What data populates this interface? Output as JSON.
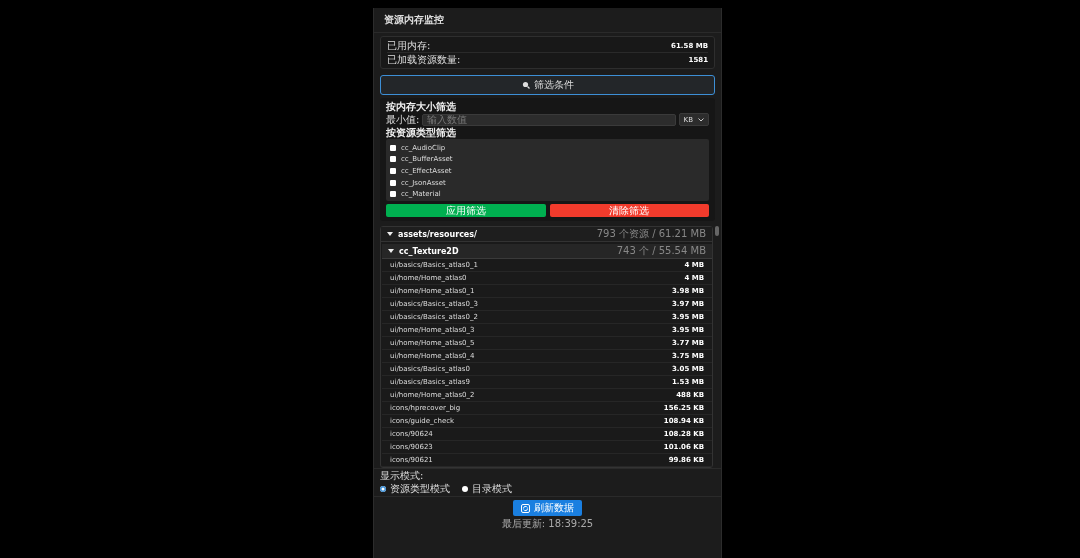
{
  "title": "资源内存监控",
  "stats": [
    {
      "label": "已用内存:",
      "value": "61.58 MB"
    },
    {
      "label": "已加载资源数量:",
      "value": "1581"
    }
  ],
  "filter_toggle": {
    "label": "筛选条件",
    "expanded": true
  },
  "filters": {
    "size_heading": "按内存大小筛选",
    "min_label": "最小值:",
    "min_input": {
      "placeholder": "输入数值"
    },
    "unit": "KB",
    "type_heading": "按资源类型筛选",
    "types": [
      {
        "label": "cc_AudioClip",
        "checked": false
      },
      {
        "label": "cc_BufferAsset",
        "checked": false
      },
      {
        "label": "cc_EffectAsset",
        "checked": false
      },
      {
        "label": "cc_JsonAsset",
        "checked": false
      },
      {
        "label": "cc_Material",
        "checked": false
      }
    ],
    "apply": "应用筛选",
    "clear": "清除筛选"
  },
  "tree": {
    "label": "assets/resources/",
    "summary": "793 个资源 / 61.21 MB",
    "expanded": true,
    "groups": [
      {
        "label": "cc_Texture2D",
        "summary": "743 个 / 55.54 MB",
        "expanded": true,
        "rows": [
          {
            "path": "ui/basics/Basics_atlas0_1",
            "size": "4 MB"
          },
          {
            "path": "ui/home/Home_atlas0",
            "size": "4 MB"
          },
          {
            "path": "ui/home/Home_atlas0_1",
            "size": "3.98 MB"
          },
          {
            "path": "ui/basics/Basics_atlas0_3",
            "size": "3.97 MB"
          },
          {
            "path": "ui/basics/Basics_atlas0_2",
            "size": "3.95 MB"
          },
          {
            "path": "ui/home/Home_atlas0_3",
            "size": "3.95 MB"
          },
          {
            "path": "ui/home/Home_atlas0_5",
            "size": "3.77 MB"
          },
          {
            "path": "ui/home/Home_atlas0_4",
            "size": "3.75 MB"
          },
          {
            "path": "ui/basics/Basics_atlas0",
            "size": "3.05 MB"
          },
          {
            "path": "ui/basics/Basics_atlas9",
            "size": "1.53 MB"
          },
          {
            "path": "ui/home/Home_atlas0_2",
            "size": "488 KB"
          },
          {
            "path": "icons/hprecover_big",
            "size": "156.25 KB"
          },
          {
            "path": "icons/guide_check",
            "size": "108.94 KB"
          },
          {
            "path": "icons/90624",
            "size": "108.28 KB"
          },
          {
            "path": "icons/90623",
            "size": "101.06 KB"
          },
          {
            "path": "icons/90621",
            "size": "99.86 KB"
          }
        ]
      }
    ]
  },
  "display_mode": {
    "label": "显示模式:",
    "options": [
      {
        "label": "资源类型模式",
        "selected": true
      },
      {
        "label": "目录模式",
        "selected": false
      }
    ]
  },
  "refresh": {
    "label": "刷新数据",
    "updated": "最后更新: 18:39:25"
  }
}
